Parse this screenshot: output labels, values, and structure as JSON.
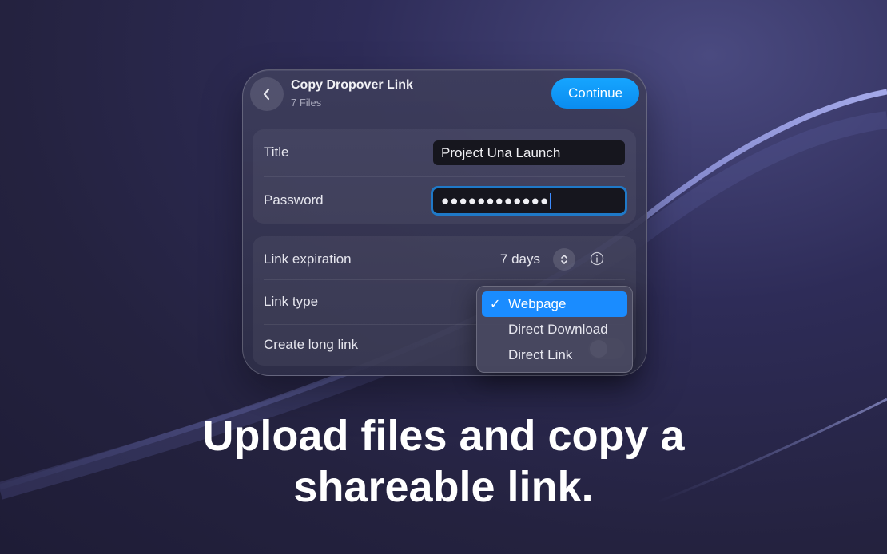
{
  "dialog": {
    "title": "Copy Dropover Link",
    "subtitle": "7 Files",
    "continue_label": "Continue"
  },
  "form": {
    "title_label": "Title",
    "title_value": "Project Una Launch",
    "password_label": "Password",
    "password_value": "●●●●●●●●●●●●",
    "expiration_label": "Link expiration",
    "expiration_value": "7 days",
    "link_type_label": "Link type",
    "long_link_label": "Create long link"
  },
  "dropdown": {
    "options": [
      {
        "label": "Webpage",
        "selected": true
      },
      {
        "label": "Direct Download",
        "selected": false
      },
      {
        "label": "Direct Link",
        "selected": false
      }
    ],
    "check_glyph": "✓"
  },
  "headline": {
    "line1": "Upload files and copy a",
    "line2": "shareable link."
  },
  "colors": {
    "accent": "#1a8cff",
    "background": "#24223f"
  },
  "icons": [
    "chevron-left-icon",
    "chevron-up-down-icon",
    "info-icon",
    "checkmark-icon"
  ]
}
